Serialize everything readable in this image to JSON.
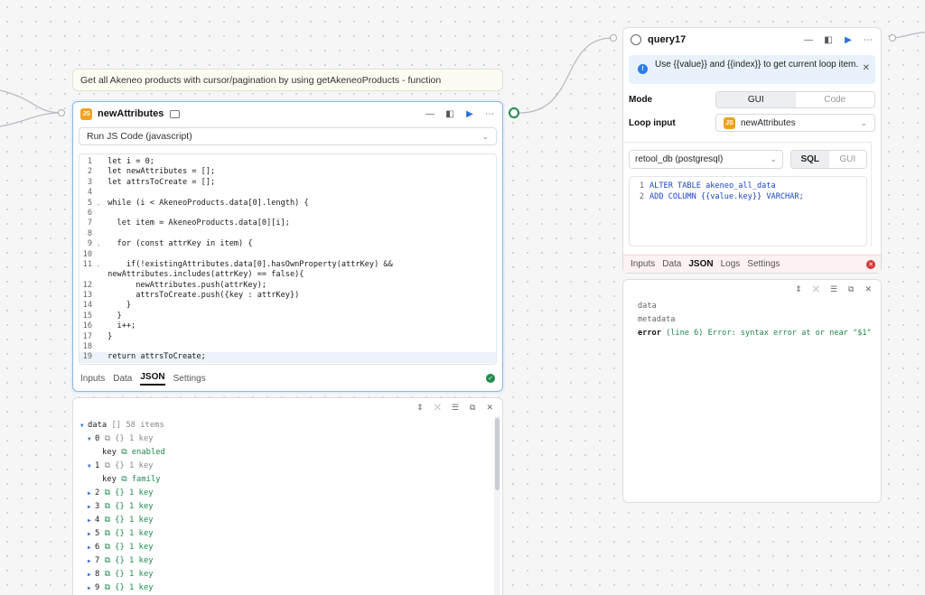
{
  "banner": {
    "text": "Get all Akeneo products with cursor/pagination by using getAkeneoProducts - function"
  },
  "left_block": {
    "badge": "JS",
    "title": "newAttributes",
    "resource": "Run JS Code (javascript)",
    "code_lines": [
      {
        "n": "1",
        "fold": "",
        "text": "let i = 0;"
      },
      {
        "n": "2",
        "fold": "",
        "text": "let newAttributes = [];"
      },
      {
        "n": "3",
        "fold": "",
        "text": "let attrsToCreate = [];"
      },
      {
        "n": "4",
        "fold": "",
        "text": ""
      },
      {
        "n": "5",
        "fold": "⌄",
        "text": "while (i < AkeneoProducts.data[0].length) {"
      },
      {
        "n": "6",
        "fold": "",
        "text": ""
      },
      {
        "n": "7",
        "fold": "",
        "text": "  let item = AkeneoProducts.data[0][i];"
      },
      {
        "n": "8",
        "fold": "",
        "text": ""
      },
      {
        "n": "9",
        "fold": "⌄",
        "text": "  for (const attrKey in item) {"
      },
      {
        "n": "10",
        "fold": "",
        "text": ""
      },
      {
        "n": "11",
        "fold": "⌄",
        "text": "    if(!existingAttributes.data[0].hasOwnProperty(attrKey) &&"
      },
      {
        "n": "",
        "fold": "",
        "text": "newAttributes.includes(attrKey) == false){"
      },
      {
        "n": "12",
        "fold": "",
        "text": "      newAttributes.push(attrKey);"
      },
      {
        "n": "13",
        "fold": "",
        "text": "      attrsToCreate.push({key : attrKey})"
      },
      {
        "n": "14",
        "fold": "",
        "text": "    }"
      },
      {
        "n": "15",
        "fold": "",
        "text": "  }"
      },
      {
        "n": "16",
        "fold": "",
        "text": "  i++;"
      },
      {
        "n": "17",
        "fold": "",
        "text": "}"
      },
      {
        "n": "18",
        "fold": "",
        "text": ""
      },
      {
        "n": "19",
        "fold": "",
        "text": "return attrsToCreate;"
      }
    ],
    "tabs": [
      "Inputs",
      "Data",
      "JSON",
      "Settings"
    ],
    "active_tab": "JSON"
  },
  "left_result": {
    "root_key": "data",
    "root_meta": "[] 58 items",
    "items": [
      {
        "idx": "0",
        "meta": "{} 1 key",
        "expanded": true,
        "child_key": "key",
        "child_val": "enabled"
      },
      {
        "idx": "1",
        "meta": "{} 1 key",
        "expanded": true,
        "child_key": "key",
        "child_val": "family"
      },
      {
        "idx": "2",
        "meta": "{} 1 key",
        "expanded": false
      },
      {
        "idx": "3",
        "meta": "{} 1 key",
        "expanded": false
      },
      {
        "idx": "4",
        "meta": "{} 1 key",
        "expanded": false
      },
      {
        "idx": "5",
        "meta": "{} 1 key",
        "expanded": false
      },
      {
        "idx": "6",
        "meta": "{} 1 key",
        "expanded": false
      },
      {
        "idx": "7",
        "meta": "{} 1 key",
        "expanded": false
      },
      {
        "idx": "8",
        "meta": "{} 1 key",
        "expanded": false
      },
      {
        "idx": "9",
        "meta": "{} 1 key",
        "expanded": false
      }
    ]
  },
  "right_block": {
    "title": "query17",
    "info_text": "Use {{value}} and {{index}} to get current loop item.",
    "mode_label": "Mode",
    "mode_options": [
      "GUI",
      "Code"
    ],
    "mode_selected": "GUI",
    "loop_label": "Loop input",
    "loop_badge": "JS",
    "loop_value": "newAttributes",
    "resource": "retool_db (postgresql)",
    "query_modes": [
      "SQL",
      "GUI"
    ],
    "query_selected": "SQL",
    "sql_lines": [
      {
        "n": "1",
        "text": "ALTER TABLE akeneo_all_data"
      },
      {
        "n": "2",
        "text": "ADD COLUMN {{value.key}} VARCHAR;"
      }
    ],
    "tabs": [
      "Inputs",
      "Data",
      "JSON",
      "Logs",
      "Settings"
    ],
    "active_tab": "JSON"
  },
  "right_result": {
    "keys": [
      "data",
      "metadata"
    ],
    "error_key": "error",
    "error_value": "(line 6) Error: syntax error at or near \"$1\""
  },
  "colors": {
    "accent": "#2a6fdc",
    "success": "#1f8a4c",
    "error": "#d93636",
    "js_badge": "#f0a21f"
  }
}
